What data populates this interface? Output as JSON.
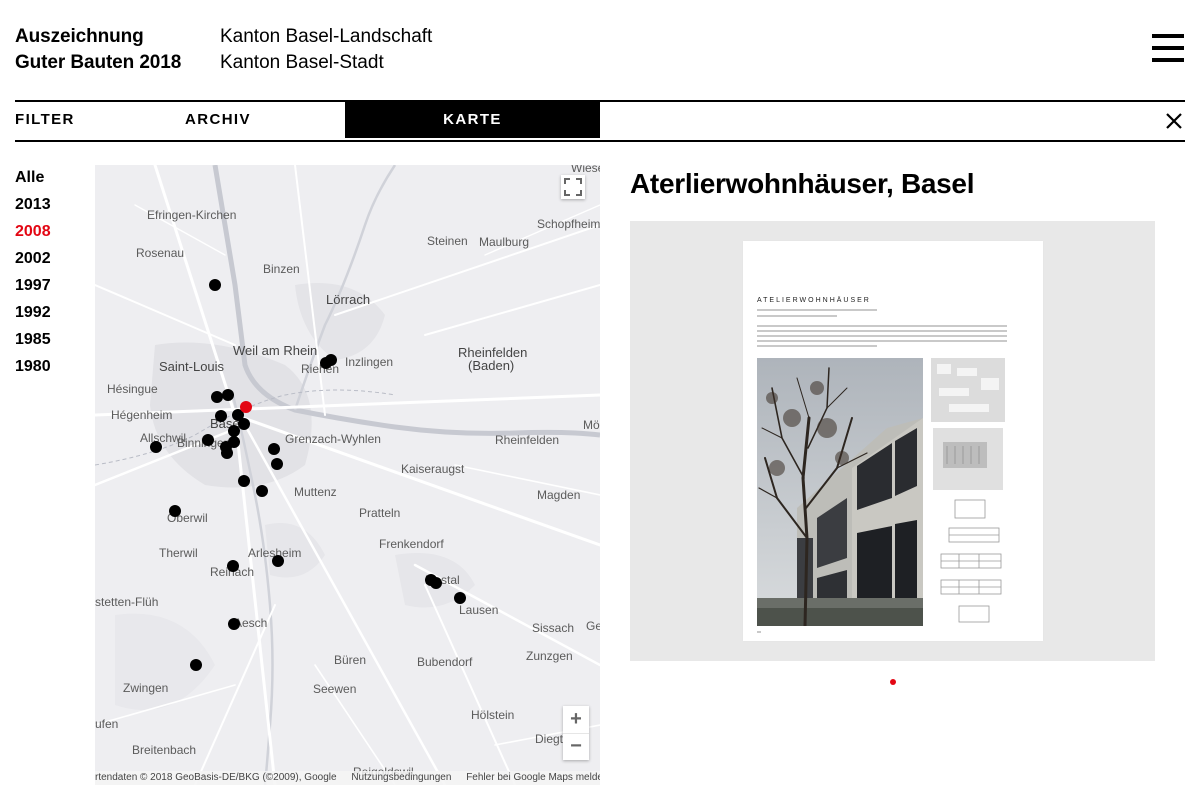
{
  "header": {
    "title_line1": "Auszeichnung",
    "title_line2": "Guter Bauten 2018",
    "canton1": "Kanton Basel-Landschaft",
    "canton2": "Kanton Basel-Stadt",
    "menu_icon": "hamburger-menu-icon"
  },
  "nav": {
    "filter": "FILTER",
    "archiv": "ARCHIV",
    "karte": "KARTE",
    "close_icon": "close-icon"
  },
  "years": {
    "items": [
      "Alle",
      "2013",
      "2008",
      "2002",
      "1997",
      "1992",
      "1985",
      "1980"
    ],
    "active": "2008",
    "active_color": "#e30613"
  },
  "map": {
    "places": {
      "wiese": "Wiese",
      "efringen": "Efringen-Kirchen",
      "schopfheim": "Schopfheim",
      "steinen": "Steinen",
      "maulburg": "Maulburg",
      "rosenau": "Rosenau",
      "binzen": "Binzen",
      "loerrach": "Lörrach",
      "weil": "Weil am Rhein",
      "saintlouis": "Saint-Louis",
      "riehen": "Riehen",
      "inzlingen": "Inzlingen",
      "rheinfelden_de": "Rheinfelden",
      "baden": "(Baden)",
      "hesingue": "Hésingue",
      "hegenheim": "Hégenheim",
      "basel": "Basel",
      "allschwil": "Allschwil",
      "grenzach": "Grenzach-Wyhlen",
      "rheinfelden": "Rheinfelden",
      "mo": "Mö",
      "binningen": "Binningen",
      "kaiseraugst": "Kaiseraugst",
      "muttenz": "Muttenz",
      "magden": "Magden",
      "oberwil": "Oberwil",
      "pratteln": "Pratteln",
      "therwil": "Therwil",
      "arlesheim": "Arlesheim",
      "frenkendorf": "Frenkendorf",
      "reinach": "Reinach",
      "liestal": "Liestal",
      "flueh": "stetten-Flüh",
      "lausen": "Lausen",
      "aesch": "Aesch",
      "sissach": "Sissach",
      "ge": "Ge",
      "bueren": "Büren",
      "bubendorf": "Bubendorf",
      "zunzgen": "Zunzgen",
      "zwingen": "Zwingen",
      "seewen": "Seewen",
      "laufen": "ufen",
      "hoelstein": "Hölstein",
      "breitenbach": "Breitenbach",
      "diegt": "Diegt",
      "reigoldswil": "Reigoldswil"
    },
    "zoom_in": "+",
    "zoom_out": "−",
    "fullscreen_icon": "fullscreen-icon",
    "attribution": "rtendaten © 2018 GeoBasis-DE/BKG (©2009), Google",
    "terms": "Nutzungsbedingungen",
    "report": "Fehler bei Google Maps melden",
    "marker_color": "#000000",
    "active_marker_color": "#e30613"
  },
  "project": {
    "title": "Aterlierwohnhäuser, Basel",
    "page_heading": "ATELIERWOHNHÄUSER",
    "slides": 1,
    "active_slide": 1
  }
}
